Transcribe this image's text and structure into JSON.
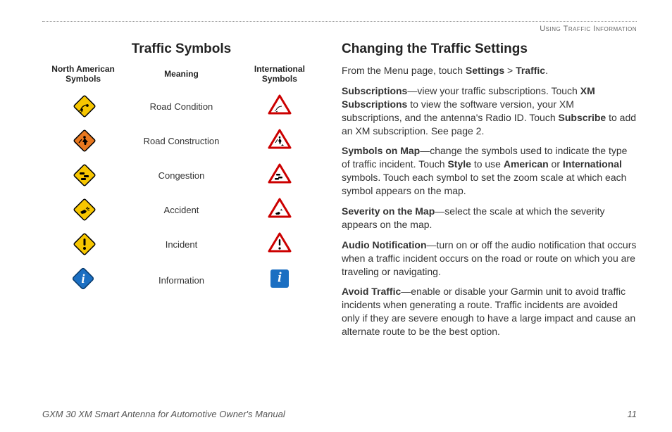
{
  "header": {
    "section": "Using Traffic Information"
  },
  "left": {
    "title": "Traffic Symbols",
    "columns": {
      "na": "North American Symbols",
      "meaning": "Meaning",
      "intl": "International Symbols"
    },
    "rows": [
      {
        "meaning": "Road Condition",
        "na_icon": "diamond-yellow-skid",
        "intl_icon": "triangle-skid"
      },
      {
        "meaning": "Road Construction",
        "na_icon": "diamond-orange-worker",
        "intl_icon": "triangle-worker"
      },
      {
        "meaning": "Congestion",
        "na_icon": "diamond-yellow-cars",
        "intl_icon": "triangle-cars"
      },
      {
        "meaning": "Accident",
        "na_icon": "diamond-yellow-crash",
        "intl_icon": "triangle-crash"
      },
      {
        "meaning": "Incident",
        "na_icon": "diamond-yellow-bang",
        "intl_icon": "triangle-bang"
      },
      {
        "meaning": "Information",
        "na_icon": "info-us",
        "intl_icon": "info-intl"
      }
    ]
  },
  "right": {
    "title": "Changing the Traffic Settings",
    "intro_pre": "From the Menu page, touch ",
    "intro_b1": "Settings",
    "intro_mid": " > ",
    "intro_b2": "Traffic",
    "intro_post": ".",
    "p1_b1": "Subscriptions",
    "p1_t1": "—view your traffic subscriptions. Touch ",
    "p1_b2": "XM Subscriptions",
    "p1_t2": " to view the software version, your XM subscriptions, and the antenna's Radio ID. Touch ",
    "p1_b3": "Subscribe",
    "p1_t3": " to add an XM subscription. See page 2.",
    "p2_b1": "Symbols on Map",
    "p2_t1": "—change the symbols used to indicate the type of traffic incident. Touch ",
    "p2_b2": "Style",
    "p2_t2": " to use ",
    "p2_b3": "American",
    "p2_t3": " or ",
    "p2_b4": "International",
    "p2_t4": " symbols. Touch each symbol to set the zoom scale at which each symbol appears on the map.",
    "p3_b1": "Severity on the Map",
    "p3_t1": "—select the scale at which the severity appears on the map.",
    "p4_b1": "Audio Notification",
    "p4_t1": "—turn on or off the audio notification that occurs when a traffic incident occurs on the road or route on which you are traveling or navigating.",
    "p5_b1": "Avoid Traffic",
    "p5_t1": "—enable or disable your Garmin unit to avoid traffic incidents when generating a route. Traffic incidents are avoided only if they are severe enough to have a large impact and cause an alternate route to be the best option."
  },
  "footer": {
    "title": "GXM 30 XM Smart Antenna for Automotive Owner's Manual",
    "page": "11"
  }
}
